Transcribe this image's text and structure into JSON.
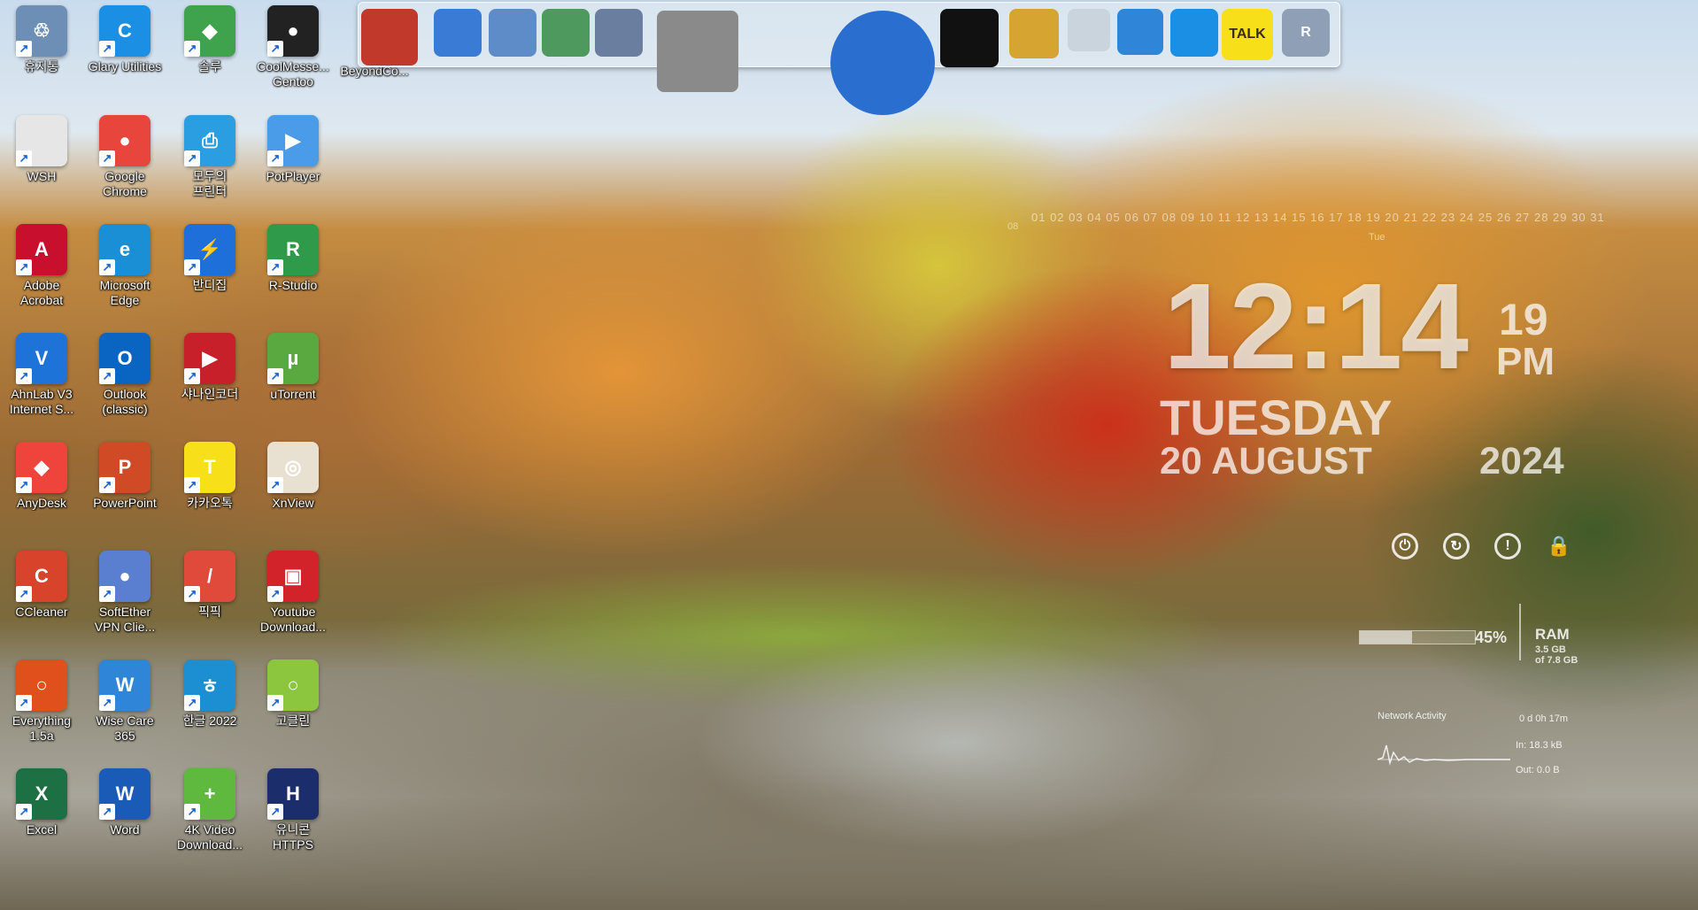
{
  "desktop": {
    "columns": [
      [
        {
          "label": "휴지통",
          "icon": "recycle-bin-icon",
          "color": "#6d8fb5",
          "glyph": "♲"
        },
        {
          "label": "WSH",
          "icon": "file-icon",
          "color": "#e6e6e6",
          "glyph": ""
        },
        {
          "label": "Adobe\nAcrobat",
          "icon": "acrobat-icon",
          "color": "#c8102e",
          "glyph": "A"
        },
        {
          "label": "AhnLab V3\nInternet S...",
          "icon": "ahnlab-v3-icon",
          "color": "#1e73d8",
          "glyph": "V"
        },
        {
          "label": "AnyDesk",
          "icon": "anydesk-icon",
          "color": "#ef443b",
          "glyph": "◆"
        },
        {
          "label": "CCleaner",
          "icon": "ccleaner-icon",
          "color": "#d8432b",
          "glyph": "C"
        },
        {
          "label": "Everything\n1.5a",
          "icon": "everything-icon",
          "color": "#e0501c",
          "glyph": "○"
        },
        {
          "label": "Excel",
          "icon": "excel-icon",
          "color": "#1d7044",
          "glyph": "X"
        }
      ],
      [
        {
          "label": "Glary Utilities",
          "icon": "glary-utilities-icon",
          "color": "#1a8fe3",
          "glyph": "C"
        },
        {
          "label": "Google\nChrome",
          "icon": "chrome-icon",
          "color": "#e8453c",
          "glyph": "●"
        },
        {
          "label": "Microsoft\nEdge",
          "icon": "edge-icon",
          "color": "#1b8fd6",
          "glyph": "e"
        },
        {
          "label": "Outlook\n(classic)",
          "icon": "outlook-icon",
          "color": "#0a64c2",
          "glyph": "O"
        },
        {
          "label": "PowerPoint",
          "icon": "powerpoint-icon",
          "color": "#d04a25",
          "glyph": "P"
        },
        {
          "label": "SoftEther\nVPN Clie...",
          "icon": "softether-vpn-icon",
          "color": "#5a7fd0",
          "glyph": "●"
        },
        {
          "label": "Wise Care\n365",
          "icon": "wise-care-icon",
          "color": "#2f86d8",
          "glyph": "W"
        },
        {
          "label": "Word",
          "icon": "word-icon",
          "color": "#1a5bb8",
          "glyph": "W"
        }
      ],
      [
        {
          "label": "솔루",
          "icon": "solu-icon",
          "color": "#3fa34d",
          "glyph": "◆"
        },
        {
          "label": "모두의\n프린터",
          "icon": "printer-icon",
          "color": "#2a9ee0",
          "glyph": "⎙"
        },
        {
          "label": "반디집",
          "icon": "bandizip-icon",
          "color": "#1e6fd9",
          "glyph": "⚡"
        },
        {
          "label": "샤나인코더",
          "icon": "shana-encoder-icon",
          "color": "#c8202a",
          "glyph": "▶"
        },
        {
          "label": "카카오톡",
          "icon": "kakaotalk-icon",
          "color": "#f7e01a",
          "glyph": "T"
        },
        {
          "label": "픽픽",
          "icon": "picpick-icon",
          "color": "#e04a3a",
          "glyph": "/"
        },
        {
          "label": "한글 2022",
          "icon": "hangul-icon",
          "color": "#1b8fd1",
          "glyph": "ㅎ"
        },
        {
          "label": "4K Video\nDownload...",
          "icon": "4k-video-downloader-icon",
          "color": "#5fb93f",
          "glyph": "+"
        }
      ],
      [
        {
          "label": "CoolMesse...\nGentoo",
          "icon": "penguin-icon",
          "color": "#222222",
          "glyph": "●"
        },
        {
          "label": "PotPlayer",
          "icon": "potplayer-icon",
          "color": "#4a9be8",
          "glyph": "▶"
        },
        {
          "label": "R-Studio",
          "icon": "r-studio-icon",
          "color": "#2e9a4a",
          "glyph": "R"
        },
        {
          "label": "uTorrent",
          "icon": "utorrent-icon",
          "color": "#5aa940",
          "glyph": "µ"
        },
        {
          "label": "XnView",
          "icon": "xnview-icon",
          "color": "#e8e0d0",
          "glyph": "◎"
        },
        {
          "label": "Youtube\nDownload...",
          "icon": "youtube-downloader-icon",
          "color": "#d2232a",
          "glyph": "▣"
        },
        {
          "label": "고클린",
          "icon": "goclean-icon",
          "color": "#8cc63f",
          "glyph": "○"
        },
        {
          "label": "유니콘\nHTTPS",
          "icon": "unicorn-https-icon",
          "color": "#1c2d6b",
          "glyph": "H"
        }
      ]
    ],
    "extra": {
      "label": "BeyondCo...",
      "icon": "beyond-compare-icon"
    }
  },
  "dock": [
    {
      "icon": "beyond-compare-dock-icon",
      "color": "#c0392b"
    },
    {
      "icon": "globe-ie-dock-icon",
      "color": "#3a7bd5"
    },
    {
      "icon": "folder-dock-icon",
      "color": "#5d8cc9"
    },
    {
      "icon": "folder-green-dock-icon",
      "color": "#4e9a5e"
    },
    {
      "icon": "folder-documents-dock-icon",
      "color": "#6a7fa0"
    },
    {
      "icon": "tools-dock-icon",
      "color": "#8a8a8a"
    },
    {
      "icon": "world-globe-dock-icon",
      "color": "#2a6fd0"
    },
    {
      "icon": "tshirt-dock-icon",
      "color": "#111111"
    },
    {
      "icon": "hammer-wrench-dock-icon",
      "color": "#d6a531"
    },
    {
      "icon": "trash-dock-icon",
      "color": "#c9d4dc"
    },
    {
      "icon": "wise-dock-icon",
      "color": "#2f86d8"
    },
    {
      "icon": "glary-dock-icon",
      "color": "#1a8fe3"
    },
    {
      "icon": "kakaotalk-dock-icon",
      "color": "#f7e01a",
      "text": "TALK"
    },
    {
      "icon": "registry-dock-icon",
      "color": "#8f9fb5",
      "text": "R"
    }
  ],
  "calendar": {
    "days": "01 02 03 04 05 06 07 08 09 10 11 12 13 14 15 16 17 18 19 20 21 22 23 24 25 26 27 28 29 30 31",
    "month": "08",
    "marker": "Tue"
  },
  "clock": {
    "time": "12:14",
    "seconds": "19",
    "ampm": "PM",
    "day": "TUESDAY",
    "date": "20 AUGUST",
    "year": "2024"
  },
  "power": [
    {
      "icon": "power-icon",
      "glyph": "⏻"
    },
    {
      "icon": "restart-icon",
      "glyph": "↻"
    },
    {
      "icon": "sleep-icon",
      "glyph": "!"
    },
    {
      "icon": "lock-icon",
      "glyph": "🔒"
    }
  ],
  "ram": {
    "percent": "45%",
    "fill": 0.45,
    "label": "RAM",
    "used": "3.5 GB",
    "total": "of 7.8 GB"
  },
  "network": {
    "title": "Network Activity",
    "uptime": "0 d 0h 17m",
    "in": "In: 18.3 kB",
    "out": "Out: 0.0 B"
  }
}
